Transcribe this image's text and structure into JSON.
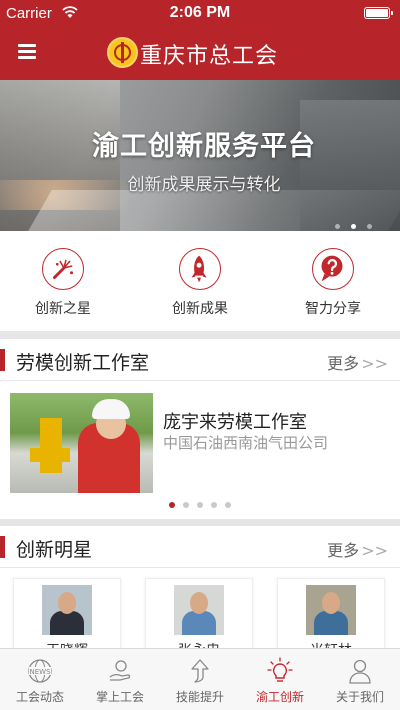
{
  "status_bar": {
    "carrier": "Carrier",
    "time": "2:06 PM"
  },
  "header": {
    "title": "重庆市总工会"
  },
  "banner": {
    "title": "渝工创新服务平台",
    "subtitle": "创新成果展示与转化",
    "slide_count": 3,
    "active_slide": 2
  },
  "quick_links": [
    {
      "label": "创新之星",
      "icon": "fireworks-icon"
    },
    {
      "label": "创新成果",
      "icon": "rocket-icon"
    },
    {
      "label": "智力分享",
      "icon": "question-icon"
    }
  ],
  "studio_section": {
    "title": "劳模创新工作室",
    "more": "更多",
    "more_chevron": ">>"
  },
  "featured_studio": {
    "title": "庞宇来劳模工作室",
    "subtitle": "中国石油西南油气田公司",
    "slide_count": 5,
    "active_slide": 1
  },
  "stars_section": {
    "title": "创新明星",
    "more": "更多",
    "more_chevron": ">>"
  },
  "stars": [
    {
      "name": "王晓辉"
    },
    {
      "name": "张永忠"
    },
    {
      "name": "米轩林"
    }
  ],
  "tabs": [
    {
      "label": "工会动态",
      "icon": "news-globe-icon",
      "active": false
    },
    {
      "label": "掌上工会",
      "icon": "hand-icon",
      "active": false
    },
    {
      "label": "技能提升",
      "icon": "arrow-up-icon",
      "active": false
    },
    {
      "label": "渝工创新",
      "icon": "lightbulb-icon",
      "active": true
    },
    {
      "label": "关于我们",
      "icon": "person-icon",
      "active": false
    }
  ],
  "colors": {
    "brand_red": "#b7242a",
    "accent_gold": "#f7c51e",
    "text_gray": "#999999"
  }
}
